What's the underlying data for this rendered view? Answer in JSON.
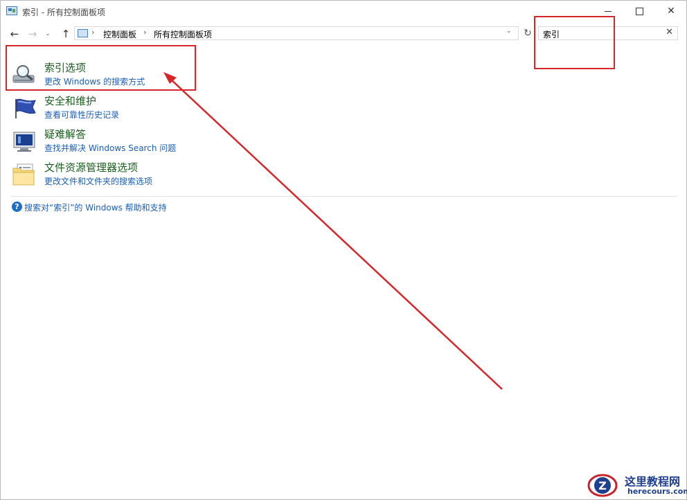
{
  "window": {
    "title": "索引 - 所有控制面板项",
    "buttons": {
      "minimize": "minimize-icon",
      "maximize": "maximize-icon",
      "close": "✕"
    }
  },
  "nav": {
    "back": "←",
    "forward": "→",
    "recent": "⌄",
    "up": "↑",
    "breadcrumbs": [
      "控制面板",
      "所有控制面板项"
    ],
    "separator": "›",
    "dropdown": "⌄",
    "refresh": "↻"
  },
  "search": {
    "value": "索引",
    "clear": "✕"
  },
  "results": [
    {
      "title": "索引选项",
      "subtitle": "更改 Windows 的搜索方式",
      "icon": "indexing-options-icon"
    },
    {
      "title": "安全和维护",
      "subtitle": "查看可靠性历史记录",
      "icon": "security-flag-icon"
    },
    {
      "title": "疑难解答",
      "subtitle": "查找并解决 Windows Search 问题",
      "icon": "troubleshooting-icon"
    },
    {
      "title": "文件资源管理器选项",
      "subtitle": "更改文件和文件夹的搜索选项",
      "icon": "folder-options-icon"
    }
  ],
  "help": {
    "icon": "?",
    "text": "搜索对“索引”的 Windows 帮助和支持"
  },
  "watermark": {
    "cn": "这里教程网",
    "en": "herecours.com",
    "logo_letter": "Z"
  },
  "colors": {
    "title_link": "#1b5e20",
    "sub_link": "#1a5fb4",
    "annotation": "#d6262b"
  }
}
